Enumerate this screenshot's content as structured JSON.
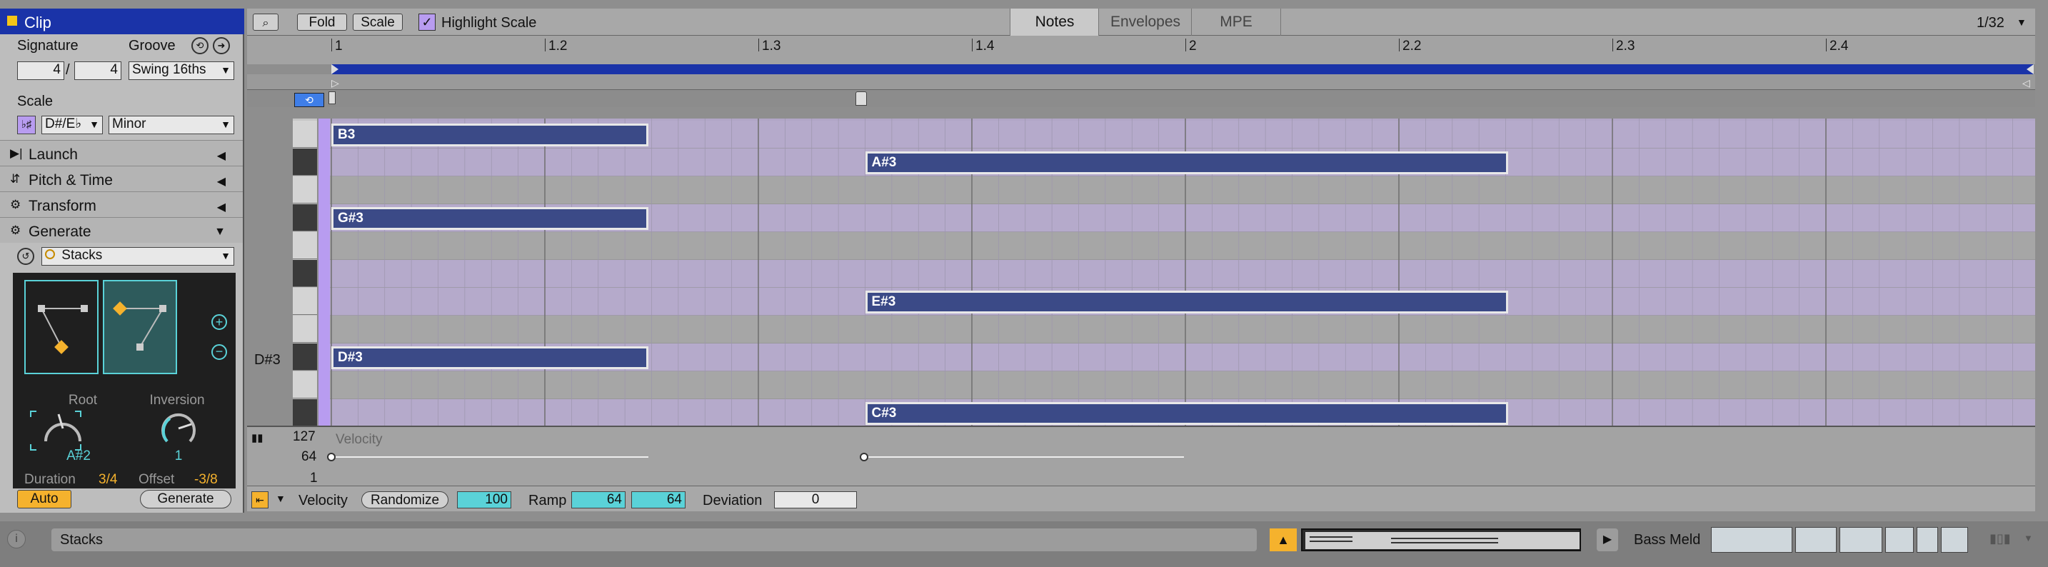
{
  "clip_panel": {
    "title": "Clip",
    "signature_label": "Signature",
    "signature_num": "4",
    "signature_den": "4",
    "groove_label": "Groove",
    "groove_value": "Swing 16ths",
    "scale_label": "Scale",
    "scale_root": "D#/E♭",
    "scale_mode": "Minor",
    "sections": [
      {
        "label": "Launch"
      },
      {
        "label": "Pitch & Time"
      },
      {
        "label": "Transform"
      },
      {
        "label": "Generate"
      }
    ],
    "generator": "Stacks",
    "root_label": "Root",
    "root_value": "A#2",
    "inversion_label": "Inversion",
    "inversion_value": "1",
    "duration_label": "Duration",
    "duration_value": "3/4",
    "offset_label": "Offset",
    "offset_value": "-3/8",
    "auto_label": "Auto",
    "generate_label": "Generate"
  },
  "toolbar": {
    "fold": "Fold",
    "scale": "Scale",
    "highlight_scale": "Highlight Scale",
    "tabs": [
      "Notes",
      "Envelopes",
      "MPE"
    ],
    "grid": "1/32"
  },
  "ruler": {
    "labels": [
      "1",
      "1.2",
      "1.3",
      "1.4",
      "2",
      "2.2",
      "2.3",
      "2.4"
    ]
  },
  "piano_roll": {
    "key_label": "D#3",
    "notes": [
      {
        "pitch": "B3",
        "start": 1.0,
        "length": 0.375
      },
      {
        "pitch": "A#3",
        "start": 1.625,
        "length": 1.375
      },
      {
        "pitch": "G#3",
        "start": 1.0,
        "length": 0.375
      },
      {
        "pitch": "E#3",
        "start": 1.625,
        "length": 1.375
      },
      {
        "pitch": "D#3",
        "start": 1.0,
        "length": 0.375
      },
      {
        "pitch": "C#3",
        "start": 1.625,
        "length": 1.375
      }
    ]
  },
  "velocity": {
    "title": "Velocity",
    "max": "127",
    "mid": "64",
    "min": "1"
  },
  "bottom_bar": {
    "velocity_label": "Velocity",
    "randomize_label": "Randomize",
    "velocity_value": "100",
    "ramp_label": "Ramp",
    "ramp_start": "64",
    "ramp_end": "64",
    "deviation_label": "Deviation",
    "deviation_value": "0"
  },
  "status_bar": {
    "info_text": "Stacks",
    "device_name": "Bass Meld"
  }
}
